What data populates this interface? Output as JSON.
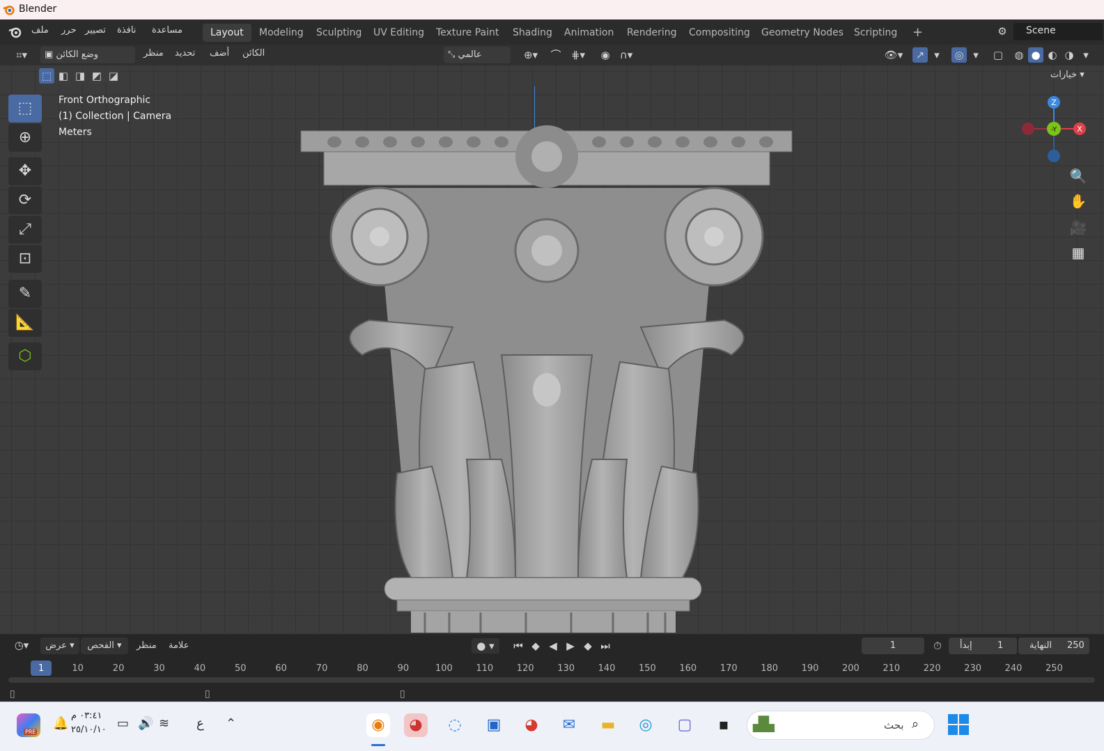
{
  "app": {
    "title": "Blender"
  },
  "menus": [
    "ملف",
    "حرر",
    "تصيير",
    "نافذة",
    "مساعدة"
  ],
  "workspaces": [
    "Layout",
    "Modeling",
    "Sculpting",
    "UV Editing",
    "Texture Paint",
    "Shading",
    "Animation",
    "Rendering",
    "Compositing",
    "Geometry Nodes",
    "Scripting"
  ],
  "workspace_add": "+",
  "scene": {
    "name": "Scene"
  },
  "header": {
    "mode": "وضع الكائن",
    "menus": [
      "منظر",
      "تحديد",
      "أضف",
      "الكائن"
    ],
    "transform_orientation": "عالمي",
    "options": "خيارات"
  },
  "viewport": {
    "view_name": "Front Orthographic",
    "collection": "(1) Collection | Camera",
    "units": "Meters",
    "gizmo": {
      "z": "Z",
      "y": "-Y",
      "x": "X"
    }
  },
  "timeline": {
    "menus": [
      "عرض",
      "الفحص",
      "منظر",
      "علامة"
    ],
    "current_frame": "1",
    "start_label": "إبدأ",
    "start_value": "1",
    "end_label": "النهاية",
    "end_value": "250",
    "ticks": [
      "1",
      "10",
      "20",
      "30",
      "40",
      "50",
      "60",
      "70",
      "80",
      "90",
      "100",
      "110",
      "120",
      "130",
      "140",
      "150",
      "160",
      "170",
      "180",
      "190",
      "200",
      "210",
      "220",
      "230",
      "240",
      "250"
    ]
  },
  "taskbar": {
    "time": "٠٣:٤١ م",
    "date": "٢٥/١٠/١٠",
    "lang": "ع",
    "search_placeholder": "بحث",
    "pre_badge": "PRE"
  },
  "colors": {
    "accent": "#4a6aa3",
    "x_axis": "#e0404a",
    "y_axis": "#7bc418",
    "z_axis": "#3a88e0"
  }
}
